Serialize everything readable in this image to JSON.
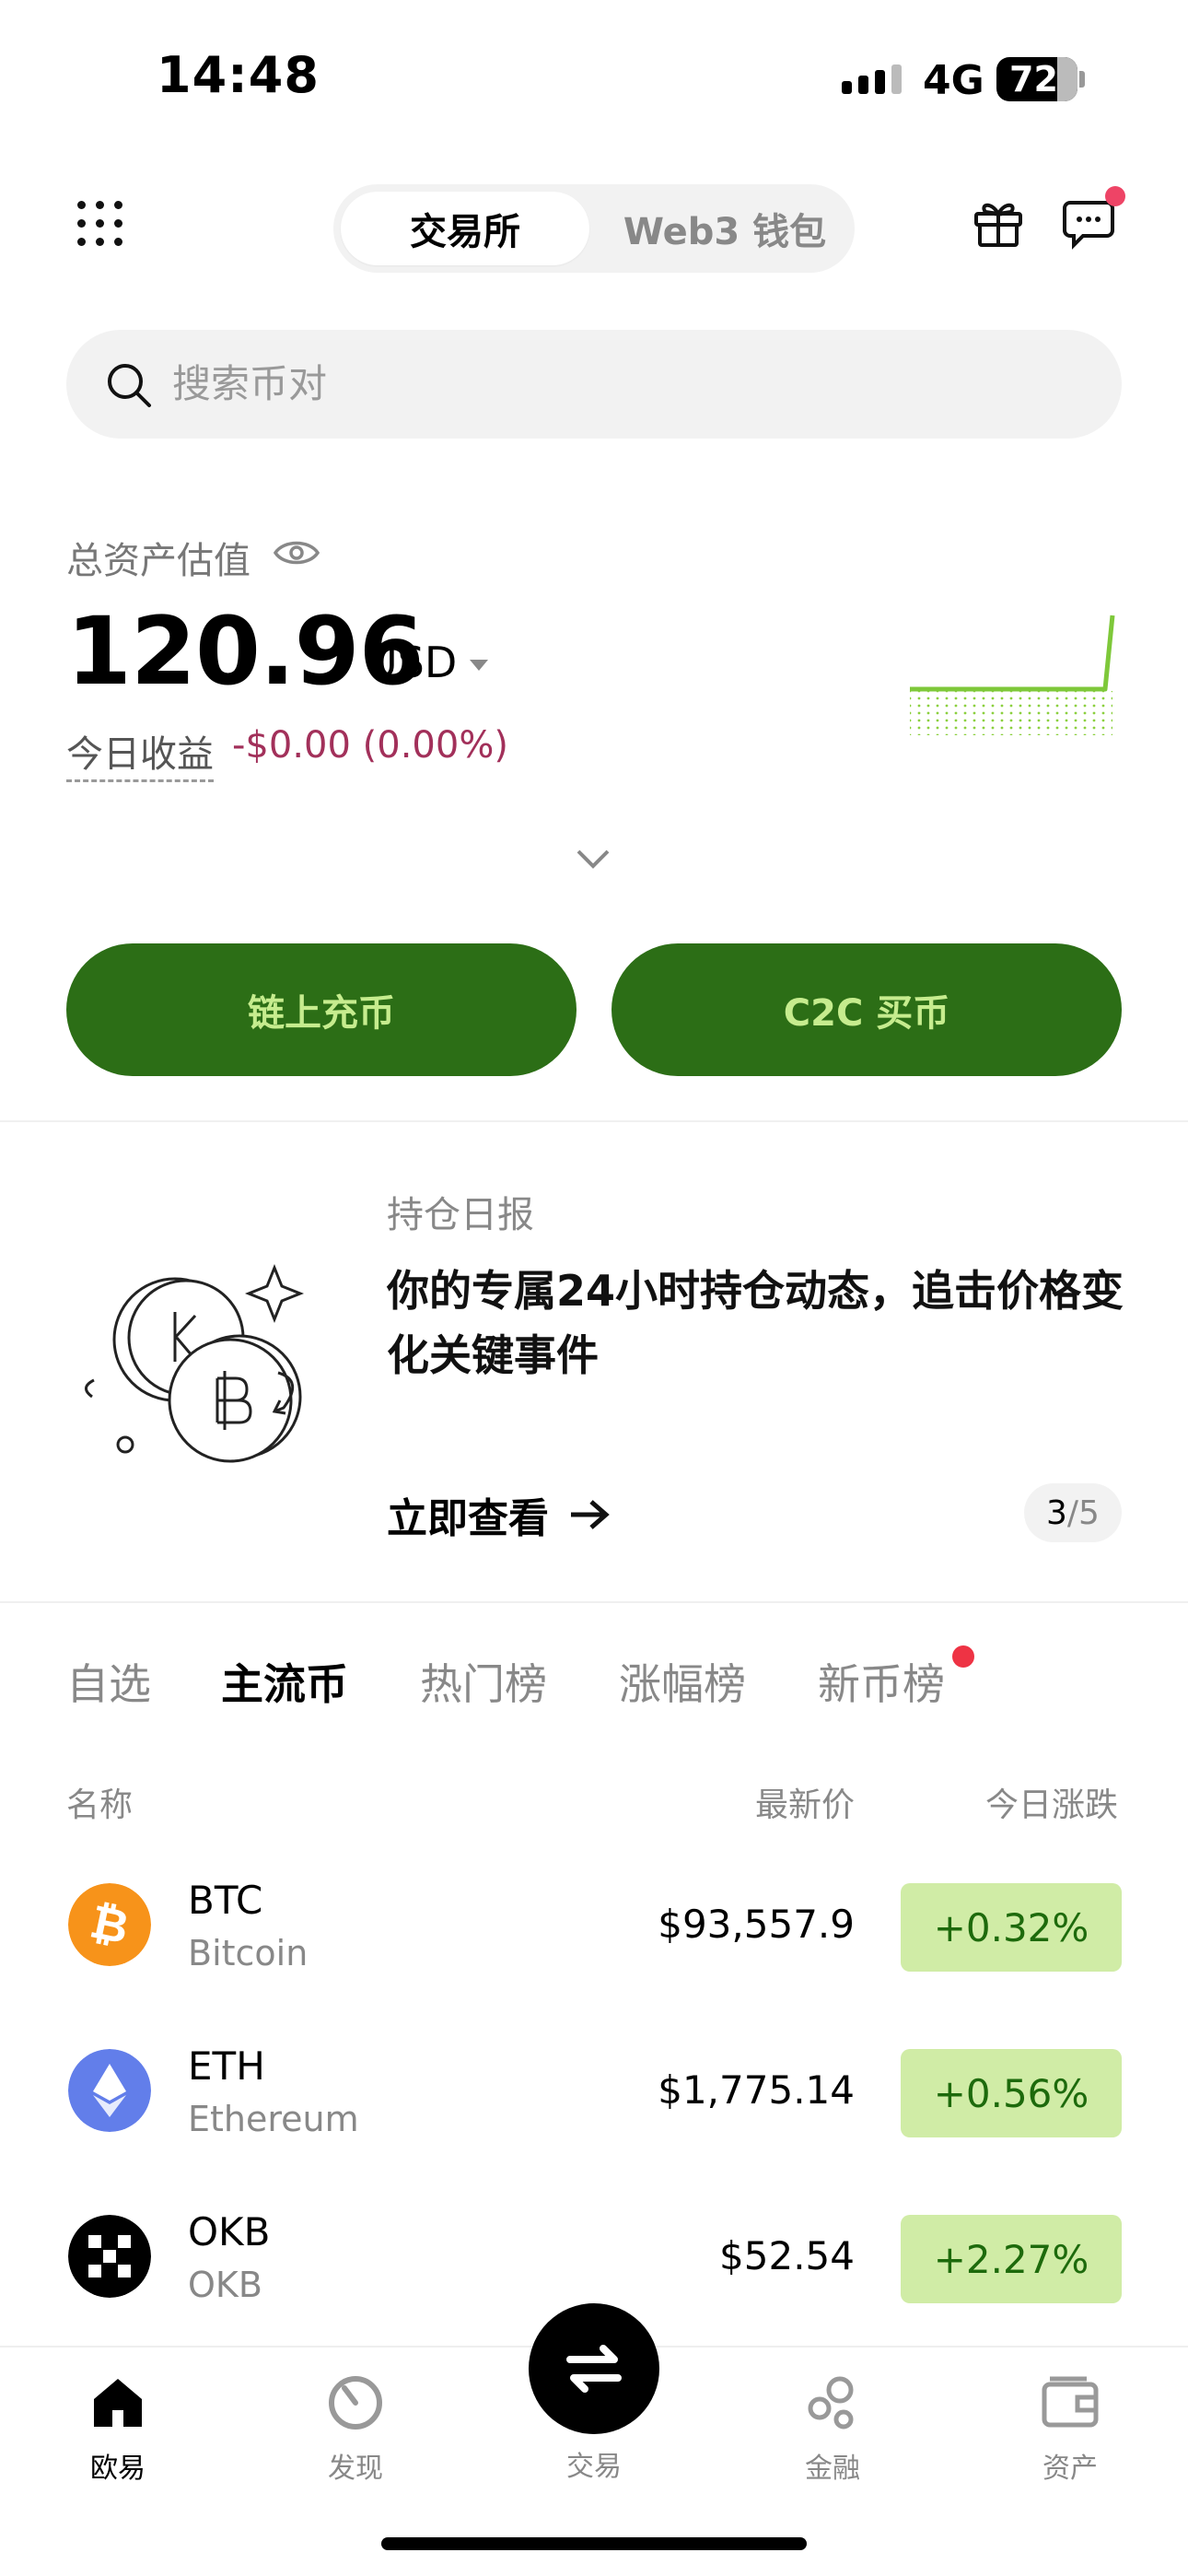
{
  "status_bar": {
    "time": "14:48",
    "network": "4G",
    "battery": "72"
  },
  "header": {
    "tabs": [
      {
        "label": "交易所",
        "active": true
      },
      {
        "label": "Web3 钱包",
        "active": false
      }
    ]
  },
  "search": {
    "placeholder": "搜索币对"
  },
  "assets": {
    "label": "总资产估值",
    "value": "120.96",
    "unit": "USD",
    "today_label": "今日收益",
    "today_value": "-$0.00 (0.00%)"
  },
  "actions": {
    "deposit": "链上充币",
    "c2c": "C2C 买币"
  },
  "report": {
    "label": "持仓日报",
    "text": "你的专属24小时持仓动态，追击价格变化关键事件",
    "link": "立即查看",
    "page_current": "3",
    "page_total": "/5"
  },
  "market_tabs": [
    "自选",
    "主流币",
    "热门榜",
    "涨幅榜",
    "新币榜"
  ],
  "market_active_index": 1,
  "table": {
    "headers": {
      "name": "名称",
      "price": "最新价",
      "change": "今日涨跌"
    },
    "rows": [
      {
        "symbol": "BTC",
        "name": "Bitcoin",
        "price": "$93,557.9",
        "change": "+0.32%",
        "color": "#f7931a"
      },
      {
        "symbol": "ETH",
        "name": "Ethereum",
        "price": "$1,775.14",
        "change": "+0.56%",
        "color": "#627eea"
      },
      {
        "symbol": "OKB",
        "name": "OKB",
        "price": "$52.54",
        "change": "+2.27%",
        "color": "#000000"
      }
    ]
  },
  "bottom_nav": [
    "欧易",
    "发现",
    "交易",
    "金融",
    "资产"
  ],
  "colors": {
    "brand_green": "#2c6e16",
    "button_text": "#c6ec8e",
    "positive_bg": "#d0eca6",
    "negative_text": "#a2305a"
  }
}
